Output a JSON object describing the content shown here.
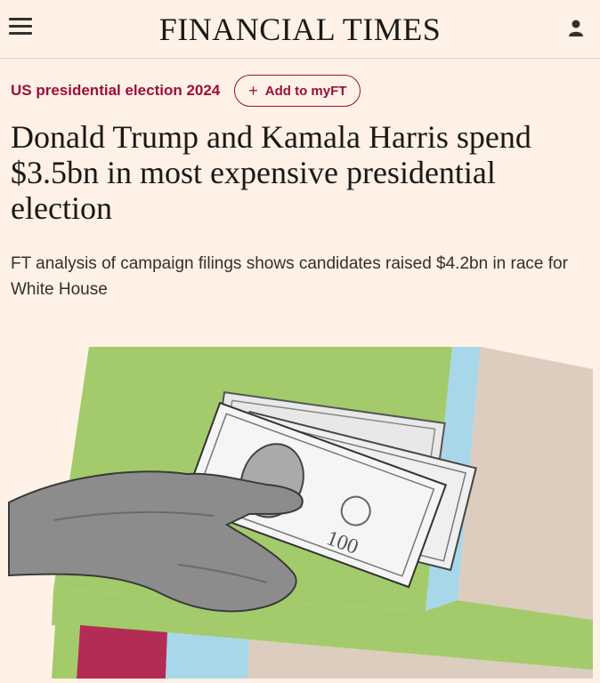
{
  "header": {
    "masthead": "FINANCIAL TIMES",
    "menu_icon": "hamburger-menu-icon",
    "account_icon": "user-account-icon"
  },
  "article": {
    "topic": "US presidential election 2024",
    "myft_button": "Add to myFT",
    "headline": "Donald Trump and Kamala Harris spend $3.5bn in most expensive presidential election",
    "standfirst": "FT analysis of campaign filings shows candidates raised $4.2bn in race for White House",
    "hero_image": "hand-holding-dollar-bills-illustration"
  },
  "colors": {
    "background": "#fff1e5",
    "brand_claret": "#990f3d",
    "hero_green": "#a3cb6b",
    "hero_blue": "#a9d7ea",
    "hero_beige": "#dccdbf",
    "hero_red": "#b32c55"
  }
}
